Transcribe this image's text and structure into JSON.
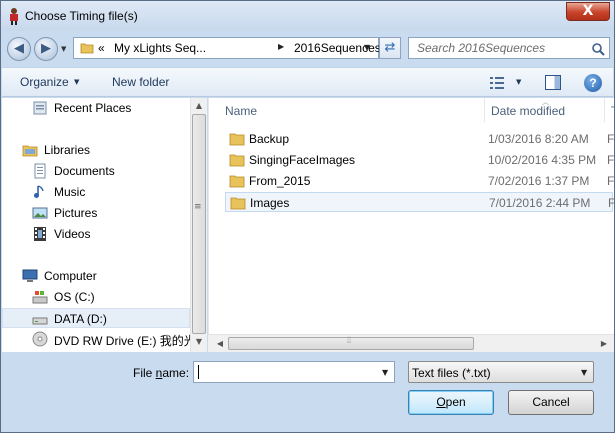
{
  "window": {
    "title": "Choose Timing file(s)",
    "close_label": "X"
  },
  "address": {
    "overflow": "«",
    "segments": [
      "My xLights Seq...",
      "2016Sequences"
    ]
  },
  "search": {
    "placeholder": "Search 2016Sequences"
  },
  "toolbar": {
    "organize_label": "Organize",
    "new_folder_label": "New folder",
    "help_label": "?"
  },
  "nav": {
    "items": [
      {
        "label": "Recent Places",
        "icon": "recent-places-icon"
      },
      {
        "label": "Libraries",
        "icon": "libraries-icon"
      },
      {
        "label": "Documents",
        "icon": "documents-icon"
      },
      {
        "label": "Music",
        "icon": "music-icon"
      },
      {
        "label": "Pictures",
        "icon": "pictures-icon"
      },
      {
        "label": "Videos",
        "icon": "videos-icon"
      },
      {
        "label": "Computer",
        "icon": "computer-icon"
      },
      {
        "label": "OS (C:)",
        "icon": "drive-icon"
      },
      {
        "label": "DATA (D:)",
        "icon": "drive-icon",
        "selected": true
      },
      {
        "label": "DVD RW Drive (E:) 我的光盘",
        "icon": "dvd-drive-icon"
      }
    ]
  },
  "files": {
    "columns": {
      "name": "Name",
      "date": "Date modified",
      "type": "T"
    },
    "rows": [
      {
        "name": "Backup",
        "date": "1/03/2016 8:20 AM",
        "type": "F"
      },
      {
        "name": "SingingFaceImages",
        "date": "10/02/2016 4:35 PM",
        "type": "F"
      },
      {
        "name": "From_2015",
        "date": "7/02/2016 1:37 PM",
        "type": "F"
      },
      {
        "name": "Images",
        "date": "7/01/2016 2:44 PM",
        "type": "F",
        "selected": true
      }
    ]
  },
  "bottom": {
    "file_name_label_prefix": "File ",
    "file_name_label_key": "n",
    "file_name_label_suffix": "ame:",
    "file_name_value": "",
    "file_type_value": "Text files (*.txt)",
    "open_key": "O",
    "open_rest": "pen",
    "cancel_label": "Cancel"
  },
  "colors": {
    "accent": "#3c7fb1",
    "frame": "#c9dbee",
    "selection": "#cce8ff"
  }
}
